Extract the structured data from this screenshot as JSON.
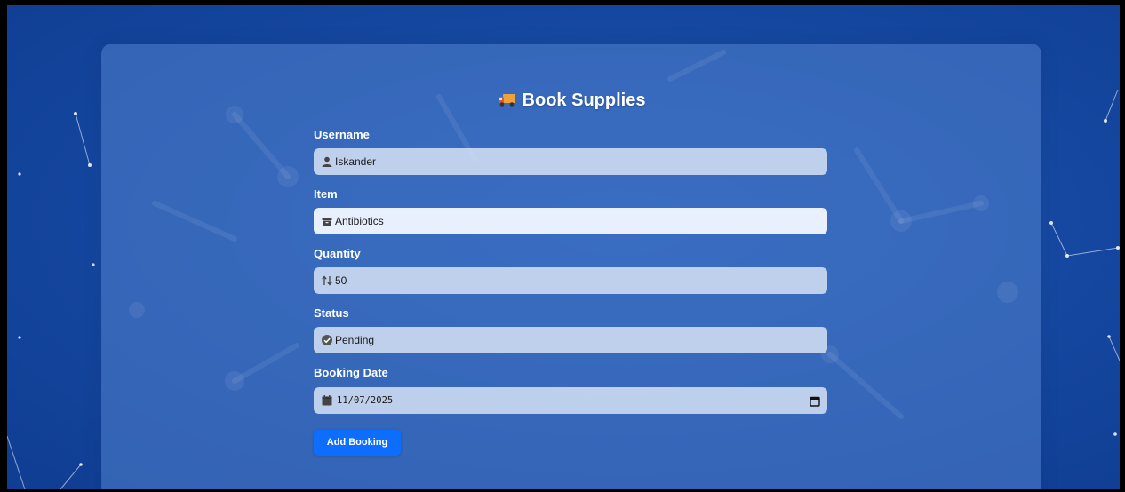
{
  "page": {
    "title": "Book Supplies",
    "title_icon": "truck-icon"
  },
  "form": {
    "username": {
      "label": "Username",
      "value": "Iskander",
      "icon": "user-icon"
    },
    "item": {
      "label": "Item",
      "value": "Antibiotics",
      "icon": "box-icon"
    },
    "quantity": {
      "label": "Quantity",
      "value": "50",
      "icon": "sort-arrows-icon"
    },
    "status": {
      "label": "Status",
      "value": "Pending",
      "icon": "check-circle-icon"
    },
    "booking_date": {
      "label": "Booking Date",
      "value": "11/07/2025",
      "icon": "calendar-icon"
    },
    "submit_label": "Add Booking"
  },
  "colors": {
    "background": "#1547a0",
    "card": "#4f7fcc",
    "field": "#c9d6ec",
    "button": "#0d6efd",
    "text_light": "#ffffff"
  }
}
